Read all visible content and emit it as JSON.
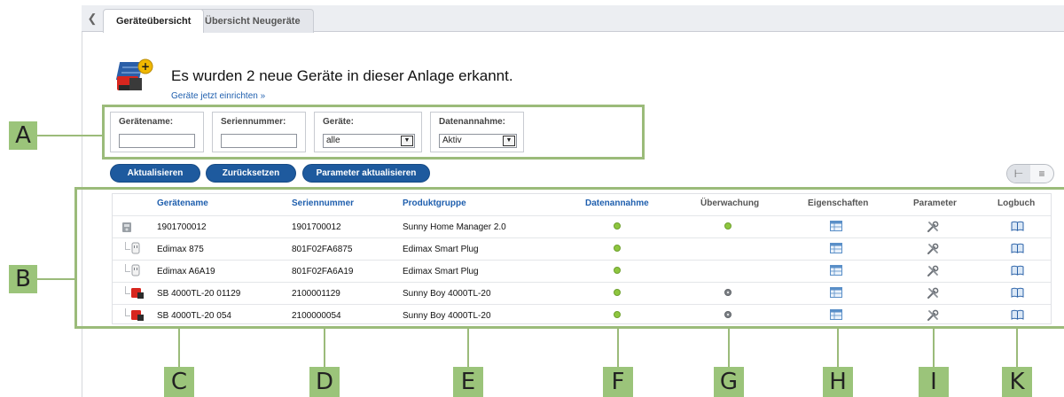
{
  "tabs": {
    "back_icon": "chevron-left-icon",
    "items": [
      {
        "label": "Geräteübersicht"
      },
      {
        "label": "Übersicht Neugeräte"
      }
    ]
  },
  "notice": {
    "title": "Es wurden 2 neue Geräte in dieser Anlage erkannt.",
    "link": "Geräte jetzt einrichten »"
  },
  "filters": {
    "name_label": "Gerätename:",
    "name_value": "",
    "serial_label": "Seriennummer:",
    "serial_value": "",
    "devices_label": "Geräte:",
    "devices_value": "alle",
    "data_label": "Datenannahme:",
    "data_value": "Aktiv"
  },
  "buttons": {
    "refresh": "Aktualisieren",
    "reset": "Zurücksetzen",
    "update_params": "Parameter aktualisieren"
  },
  "table": {
    "headers": {
      "name": "Gerätename",
      "serial": "Seriennummer",
      "group": "Produktgruppe",
      "data": "Datenannahme",
      "monitoring": "Überwachung",
      "properties": "Eigenschaften",
      "parameters": "Parameter",
      "logbook": "Logbuch"
    },
    "rows": [
      {
        "name": "1901700012",
        "serial": "1901700012",
        "group": "Sunny Home Manager 2.0",
        "data": "green",
        "monitoring": "green",
        "device_icon": "home-manager-icon"
      },
      {
        "name": "Edimax 875",
        "serial": "801F02FA6875",
        "group": "Edimax Smart Plug",
        "data": "green",
        "monitoring": "",
        "device_icon": "smart-plug-icon"
      },
      {
        "name": "Edimax A6A19",
        "serial": "801F02FA6A19",
        "group": "Edimax Smart Plug",
        "data": "green",
        "monitoring": "",
        "device_icon": "smart-plug-icon"
      },
      {
        "name": "SB 4000TL-20 01129",
        "serial": "2100001129",
        "group": "Sunny Boy 4000TL-20",
        "data": "green",
        "monitoring": "gray",
        "device_icon": "inverter-icon"
      },
      {
        "name": "SB 4000TL-20 054",
        "serial": "2100000054",
        "group": "Sunny Boy 4000TL-20",
        "data": "green",
        "monitoring": "gray",
        "device_icon": "inverter-icon"
      }
    ]
  },
  "annotations": {
    "side": [
      "A",
      "B"
    ],
    "bottom": [
      "C",
      "D",
      "E",
      "F",
      "G",
      "H",
      "I",
      "K"
    ]
  },
  "colors": {
    "accent_blue": "#1e5a9e",
    "annotation_green": "#9bc47a",
    "status_green": "#8ec63f",
    "status_gray": "#7e8287"
  }
}
